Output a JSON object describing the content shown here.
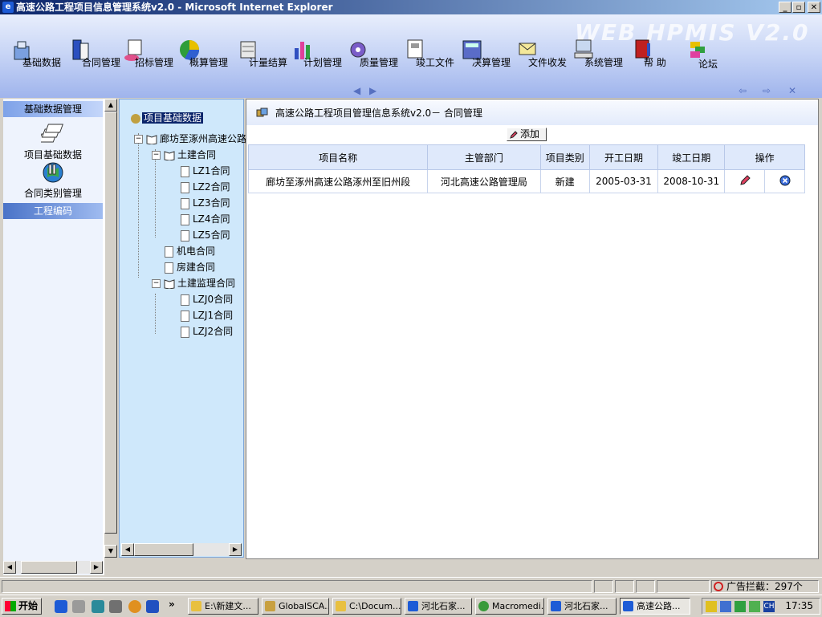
{
  "window": {
    "title": "高速公路工程项目信息管理系统v2.0 - Microsoft Internet Explorer",
    "min_label": "_",
    "max_label": "▫",
    "close_label": "✕"
  },
  "banner": {
    "brand": "WEB HPMIS  V2.0"
  },
  "toolbar": {
    "items": [
      {
        "label": "基础数据"
      },
      {
        "label": "合同管理"
      },
      {
        "label": "招标管理"
      },
      {
        "label": "概算管理"
      },
      {
        "label": "计量结算"
      },
      {
        "label": "计划管理"
      },
      {
        "label": "质量管理"
      },
      {
        "label": "竣工文件"
      },
      {
        "label": "决算管理"
      },
      {
        "label": "文件收发"
      },
      {
        "label": "系统管理"
      },
      {
        "label": "帮 助"
      },
      {
        "label": "论坛"
      }
    ]
  },
  "sidebar": {
    "section1": "基础数据管理",
    "items": [
      {
        "label": "项目基础数据"
      },
      {
        "label": "合同类别管理"
      }
    ],
    "section2": "工程编码"
  },
  "tree": {
    "root": "项目基础数据",
    "project": "廊坊至涿州高速公路",
    "civil": "土建合同",
    "civil_children": [
      "LZ1合同",
      "LZ2合同",
      "LZ3合同",
      "LZ4合同",
      "LZ5合同"
    ],
    "mech": "机电合同",
    "building": "房建合同",
    "supervision": "土建监理合同",
    "supervision_children": [
      "LZJ0合同",
      "LZJ1合同",
      "LZJ2合同"
    ]
  },
  "main": {
    "heading": "高速公路工程项目管理信息系统v2.0－ 合同管理",
    "add_label": "添加",
    "columns": [
      "项目名称",
      "主管部门",
      "项目类别",
      "开工日期",
      "竣工日期",
      "操作"
    ],
    "rows": [
      {
        "name": "廊坊至涿州高速公路涿州至旧州段",
        "dept": "河北高速公路管理局",
        "category": "新建",
        "start": "2005-03-31",
        "end": "2008-10-31"
      }
    ]
  },
  "statusbar": {
    "blocked": "广告拦截：297个"
  },
  "taskbar": {
    "start": "开始",
    "more": "»",
    "tasks": [
      {
        "label": "E:\\新建文..."
      },
      {
        "label": "GlobalSCA..."
      },
      {
        "label": "C:\\Docum..."
      },
      {
        "label": "河北石家..."
      },
      {
        "label": "Macromedi..."
      },
      {
        "label": "河北石家..."
      },
      {
        "label": "高速公路..."
      }
    ],
    "lang": "CH",
    "clock": "17:35"
  },
  "colors": {
    "titlebar": "#0a246a",
    "tree_bg": "#cfe8fb",
    "header_blue": "#4a73c8"
  }
}
